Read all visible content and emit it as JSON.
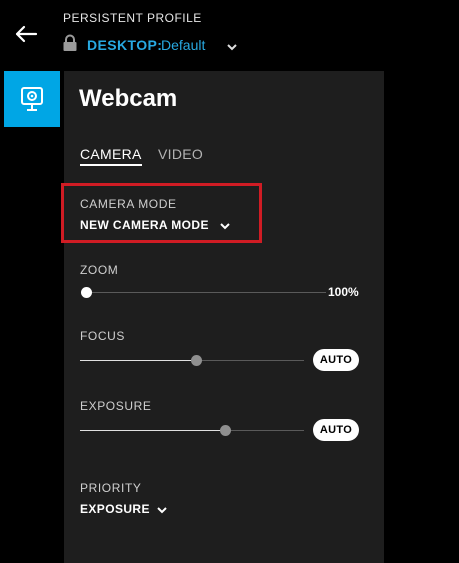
{
  "header": {
    "profile_label": "PERSISTENT PROFILE",
    "profile_key": "DESKTOP:",
    "profile_value": "Default"
  },
  "sidebar": {
    "items": [
      {
        "name": "webcam",
        "icon": "webcam-icon",
        "active": true
      }
    ]
  },
  "panel": {
    "title": "Webcam",
    "tabs": [
      {
        "label": "CAMERA",
        "active": true
      },
      {
        "label": "VIDEO",
        "active": false
      }
    ],
    "camera_mode": {
      "label": "CAMERA MODE",
      "value": "NEW CAMERA MODE"
    },
    "zoom": {
      "label": "ZOOM",
      "value_text": "100%",
      "level": 0.0
    },
    "focus": {
      "label": "FOCUS",
      "level": 0.52,
      "auto_label": "AUTO"
    },
    "exposure": {
      "label": "EXPOSURE",
      "level": 0.65,
      "auto_label": "AUTO"
    },
    "priority": {
      "label": "PRIORITY",
      "value": "EXPOSURE"
    }
  },
  "colors": {
    "accent": "#28a9e1",
    "active_tile": "#00a6e5",
    "highlight_box": "#d01c24",
    "panel_bg": "#1e1e1e"
  }
}
